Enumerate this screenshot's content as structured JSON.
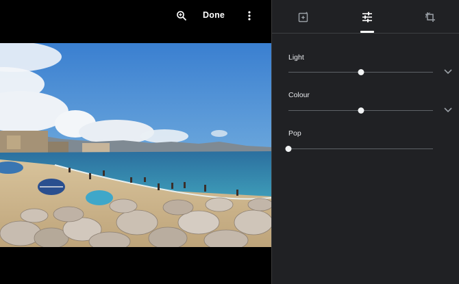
{
  "toolbar": {
    "done_label": "Done",
    "zoom_icon": "zoom-in-icon",
    "more_icon": "more-vert-icon"
  },
  "photo": {
    "subject": "beach-scene",
    "colors": {
      "sky": "#3f86d0",
      "sea": "#2a7aa8",
      "sand": "#c9b28a",
      "rocks": "#b8aa98"
    }
  },
  "panel": {
    "tabs": [
      {
        "icon": "auto-fix-icon",
        "active": false
      },
      {
        "icon": "tune-icon",
        "active": true
      },
      {
        "icon": "crop-rotate-icon",
        "active": false
      }
    ],
    "sliders": [
      {
        "label": "Light",
        "value": 0.5,
        "expandable": true
      },
      {
        "label": "Colour",
        "value": 0.5,
        "expandable": true
      },
      {
        "label": "Pop",
        "value": 0.0,
        "expandable": false
      }
    ],
    "colors": {
      "background": "#202124",
      "text": "#e8eaed",
      "track": "#5f6368",
      "thumb": "#f1f3f4"
    }
  }
}
